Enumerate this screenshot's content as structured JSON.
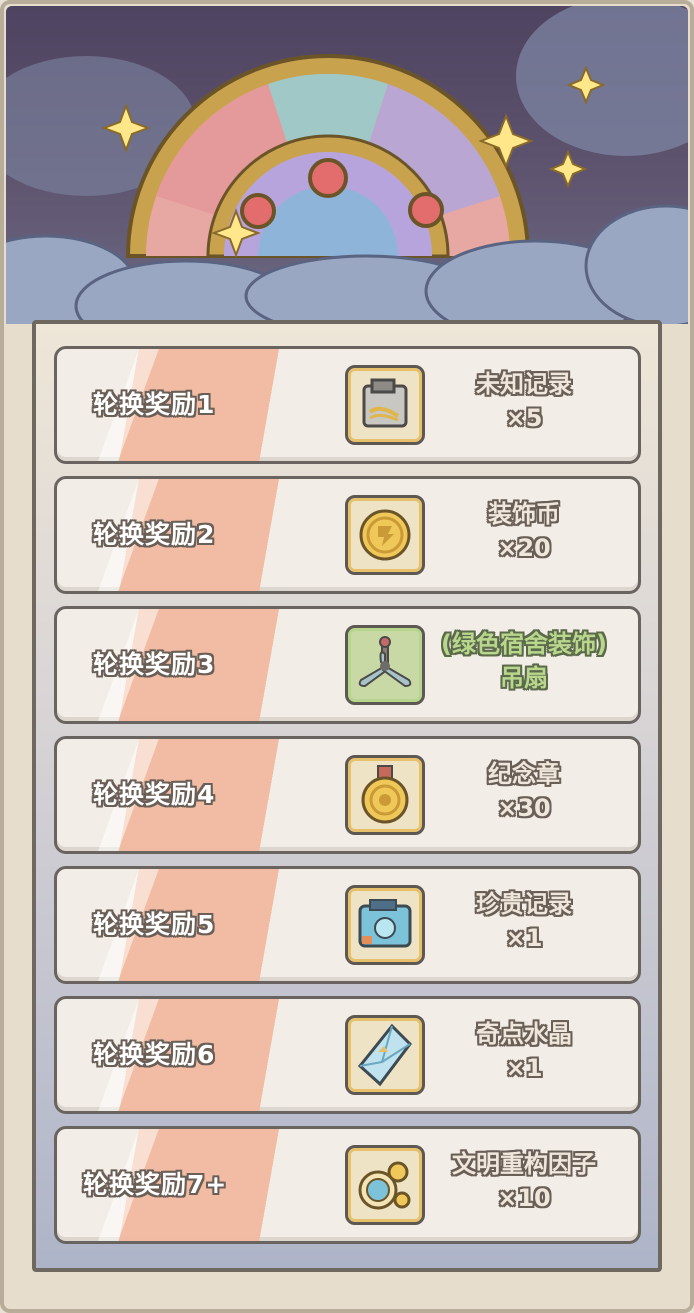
{
  "rewards": [
    {
      "label": "轮换奖励1",
      "item": "未知记录",
      "qty": "×5",
      "icon": "unknown-record-icon",
      "green": false
    },
    {
      "label": "轮换奖励2",
      "item": "装饰币",
      "qty": "×20",
      "icon": "decoration-coin-icon",
      "green": false
    },
    {
      "label": "轮换奖励3",
      "item": "(绿色宿舍装饰)",
      "qty": "吊扇",
      "icon": "ceiling-fan-icon",
      "green": true
    },
    {
      "label": "轮换奖励4",
      "item": "纪念章",
      "qty": "×30",
      "icon": "medal-icon",
      "green": false
    },
    {
      "label": "轮换奖励5",
      "item": "珍贵记录",
      "qty": "×1",
      "icon": "precious-record-icon",
      "green": false
    },
    {
      "label": "轮换奖励6",
      "item": "奇点水晶",
      "qty": "×1",
      "icon": "singularity-crystal-icon",
      "green": false
    },
    {
      "label": "轮换奖励7+",
      "item": "文明重构因子",
      "qty": "×10",
      "icon": "civilization-factor-icon",
      "green": false
    }
  ],
  "colors": {
    "stripe": "#f2b9a0",
    "outline": "#6a5f56",
    "accent_green": "#b9d68d",
    "gold": "#e7c06a"
  }
}
